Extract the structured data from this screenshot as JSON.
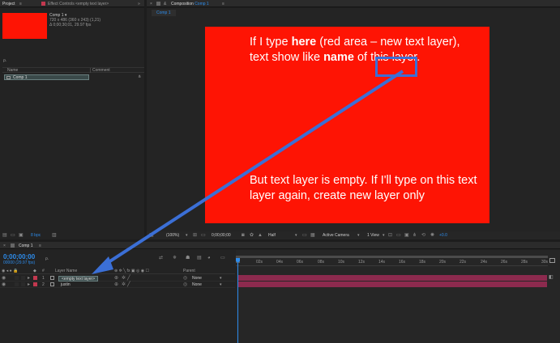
{
  "project_panel": {
    "tab_project": "Project",
    "tab_effect_controls": "Effect Controls <empty text layer>",
    "comp_name": "Comp 1 ▾",
    "comp_size": "720 x 486 (360 x 243) (1,21)",
    "comp_duration": "Δ 0;00;30;01, 29.97 fps",
    "search_placeholder": "ρ.",
    "col_name": "Name",
    "col_comment": "Comment",
    "item_comp": "Comp 1",
    "bpc": "8 bpc"
  },
  "composition_panel": {
    "tab_label": "Composition",
    "tab_comp": "Comp 1",
    "sub_tab": "Comp 1",
    "text_top_1": "If I type ",
    "text_top_bold": "here",
    "text_top_2": " (red area – new text layer),  text show like ",
    "text_top_bold2": "name",
    "text_top_3": " of this layer.",
    "text_bottom": "But text layer is empty. If I'll type on this text layer again, create new layer only",
    "zoom": "(100%)",
    "timecode": "0;00;00;00",
    "resolution": "Half",
    "camera": "Active Camera",
    "view": "1 View",
    "exposure": "+0.0"
  },
  "timeline": {
    "tab_label": "Comp 1",
    "timecode": "0;00;00;00",
    "frames": "00000 (29.97 fps)",
    "search_placeholder": "ρ.",
    "col_num": "#",
    "col_layer_name": "Layer Name",
    "col_parent": "Parent",
    "ruler_labels": [
      "0s",
      "02s",
      "04s",
      "06s",
      "08s",
      "10s",
      "12s",
      "14s",
      "16s",
      "18s",
      "20s",
      "22s",
      "24s",
      "26s",
      "28s",
      "30s"
    ],
    "layers": [
      {
        "num": "1",
        "name": "<empty text layer>",
        "parent": "None",
        "color": "#c2384f"
      },
      {
        "num": "2",
        "name": "justin",
        "parent": "None",
        "color": "#c2384f"
      }
    ]
  },
  "colors": {
    "comp_red": "#fe1404",
    "annotation_blue": "#3b6fd6",
    "track_bar": "#8c2a4e"
  }
}
